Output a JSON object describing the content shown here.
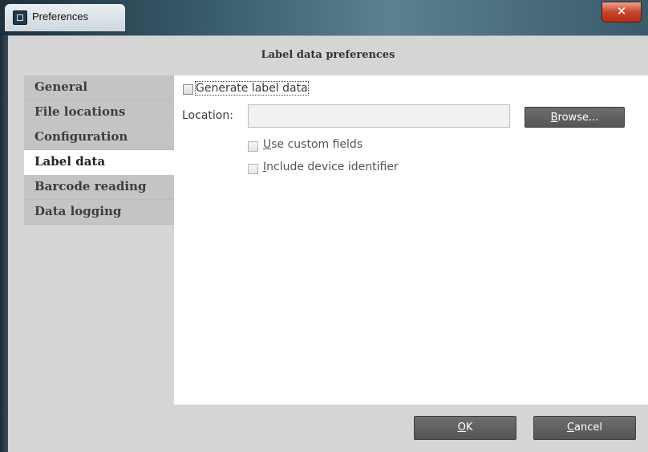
{
  "window": {
    "title": "Preferences",
    "close_glyph": "✕",
    "app_icon": "preferences-app-icon"
  },
  "header": {
    "title": "Label data preferences"
  },
  "nav": {
    "items": [
      {
        "label": "General",
        "active": false
      },
      {
        "label": "File locations",
        "active": false
      },
      {
        "label": "Configuration",
        "active": false
      },
      {
        "label": "Label data",
        "active": true
      },
      {
        "label": "Barcode reading",
        "active": false
      },
      {
        "label": "Data logging",
        "active": false
      }
    ]
  },
  "content": {
    "generate": {
      "label": "Generate label data",
      "checked": false
    },
    "location": {
      "label": "Location:",
      "value": "",
      "placeholder": ""
    },
    "browse": {
      "label_underlined": "B",
      "label_rest": "rowse..."
    },
    "custom_fields": {
      "label_underlined": "U",
      "label_rest": "se custom fields",
      "checked": false,
      "enabled": false
    },
    "device_id": {
      "label_underlined": "I",
      "label_rest": "nclude device identifier",
      "checked": false,
      "enabled": false
    }
  },
  "footer": {
    "ok": {
      "label_underlined": "O",
      "label_rest": "K"
    },
    "cancel": {
      "label_underlined": "C",
      "label_rest": "ancel"
    }
  },
  "colors": {
    "button_bg": "#5f5f5f",
    "nav_bg": "#c4c4c4",
    "client_bg": "#d5d5d5"
  }
}
